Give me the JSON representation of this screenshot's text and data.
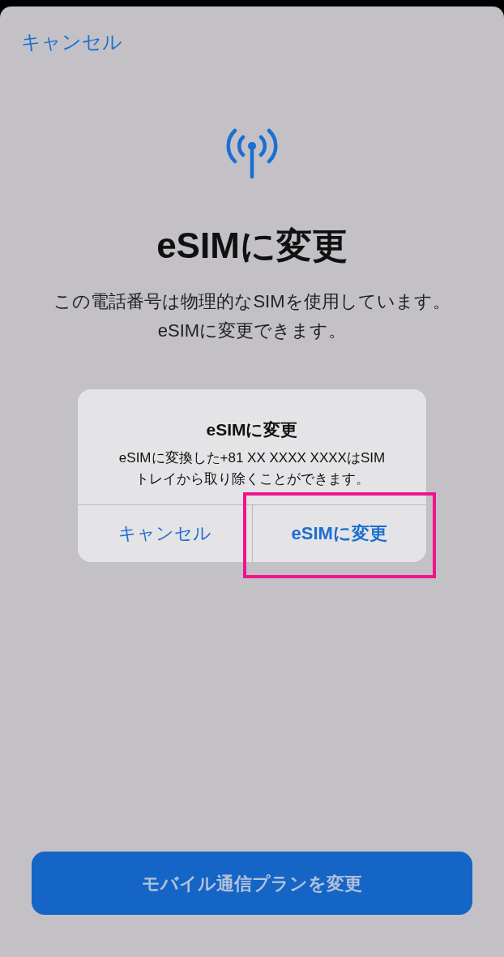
{
  "nav": {
    "cancel": "キャンセル"
  },
  "title": "eSIMに変更",
  "description": "この電話番号は物理的なSIMを使用しています。eSIMに変更できます。",
  "alert": {
    "title": "eSIMに変更",
    "message": "eSIMに変換した+81 XX XXXX XXXXはSIMトレイから取り除くことができます。",
    "buttons": [
      {
        "label": "キャンセル",
        "kind": "cancel",
        "highlighted": false
      },
      {
        "label": "eSIMに変更",
        "kind": "confirm",
        "highlighted": true
      }
    ]
  },
  "primary_button": {
    "label": "モバイル通信プランを変更",
    "disabled": true
  }
}
